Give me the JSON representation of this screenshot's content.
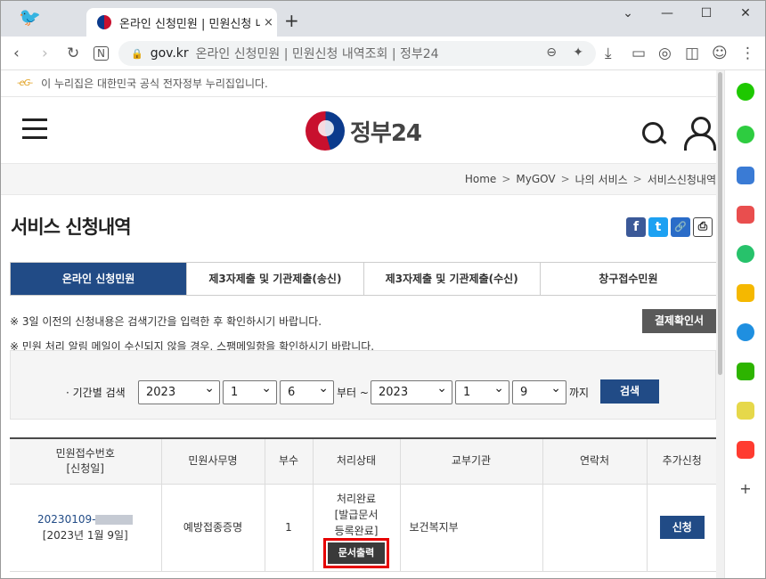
{
  "browser": {
    "tab_title": "온라인 신청민원 | 민원신청 내역",
    "tab_close": "×",
    "new_tab": "+",
    "window_min": "—",
    "window_max": "☐",
    "window_close": "✕",
    "url_domain": "gov.kr",
    "url_page_title": "온라인 신청민원 | 민원신청 내역조회 | 정부24"
  },
  "site": {
    "gov_notice": "이 누리집은 대한민국 공식 전자정부 누리집입니다.",
    "gov_mark": "-eG-",
    "logo_text": "정부24"
  },
  "breadcrumb": [
    "Home",
    "MyGOV",
    "나의 서비스",
    "서비스신청내역"
  ],
  "breadcrumb_sep": ">",
  "page_title": "서비스 신청내역",
  "share": {
    "facebook": "f",
    "twitter": "t",
    "link": "🔗",
    "print": "⎙"
  },
  "tabs": [
    "온라인 신청민원",
    "제3자제출 및 기관제출(송신)",
    "제3자제출 및 기관제출(수신)",
    "창구접수민원"
  ],
  "notes": [
    "※ 3일 이전의 신청내용은 검색기간을 입력한 후 확인하시기 바랍니다.",
    "※ 민원 처리 알림 메일이 수신되지 않을 경우, 스팸메일함을 확인하시기 바랍니다."
  ],
  "payment_button": "결제확인서",
  "filter": {
    "label": "· 기간별 검색",
    "from_year": "2023",
    "from_month": "1",
    "from_day": "6",
    "from_text": "부터 ~",
    "to_year": "2023",
    "to_month": "1",
    "to_day": "9",
    "to_text": "까지",
    "search_button": "검색"
  },
  "table": {
    "headers": [
      "민원접수번호",
      "[신청일]",
      "민원사무명",
      "부수",
      "처리상태",
      "교부기관",
      "연락처",
      "추가신청"
    ],
    "rows": [
      {
        "receipt_no": "20230109-",
        "date": "[2023년 1월 9일]",
        "service": "예방접종증명",
        "copies": "1",
        "status1": "처리완료",
        "status2": "[발급문서",
        "status3": "등록완료]",
        "print_button": "문서출력",
        "agency": "보건복지부",
        "contact": "",
        "apply_button": "신청"
      }
    ]
  }
}
